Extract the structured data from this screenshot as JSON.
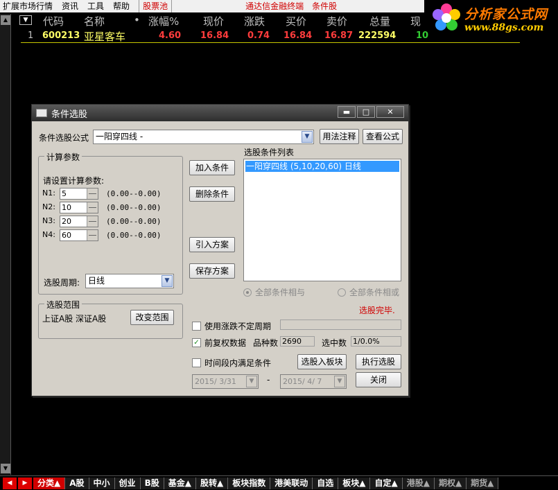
{
  "menu": {
    "items": [
      "扩展市场行情",
      "资讯",
      "工具",
      "帮助"
    ],
    "stock_pool": "股票池",
    "terminal": "通达信金融终端",
    "condition_stock": "条件股"
  },
  "logo": {
    "brand": "分析家公式网",
    "url": "www.88gs.com"
  },
  "table": {
    "headers": [
      "代码",
      "名称",
      "•",
      "涨幅%",
      "现价",
      "涨跌",
      "买价",
      "卖价",
      "总量",
      "现"
    ],
    "row": {
      "index": "1",
      "code": "600213",
      "name": "亚星客车",
      "change_pct": "4.60",
      "price": "16.84",
      "change": "0.74",
      "bid": "16.84",
      "ask": "16.87",
      "volume": "222594",
      "cur": "10"
    }
  },
  "dialog": {
    "title": "条件选股",
    "formula_label": "条件选股公式",
    "formula_value": "一阳穿四线    -",
    "btn_usage": "用法注释",
    "btn_view": "查看公式",
    "params_group": "计算参数",
    "params_hint": "请设置计算参数:",
    "params": [
      {
        "name": "N1:",
        "value": "5",
        "range": "(0.00--0.00)"
      },
      {
        "name": "N2:",
        "value": "10",
        "range": "(0.00--0.00)"
      },
      {
        "name": "N3:",
        "value": "20",
        "range": "(0.00--0.00)"
      },
      {
        "name": "N4:",
        "value": "60",
        "range": "(0.00--0.00)"
      }
    ],
    "period_label": "选股周期:",
    "period_value": "日线",
    "btn_add": "加入条件",
    "btn_delete": "删除条件",
    "btn_import": "引入方案",
    "btn_save": "保存方案",
    "list_label": "选股条件列表",
    "list_item": "一阳穿四线 (5,10,20,60) 日线",
    "radio_and": "全部条件相与",
    "radio_or": "全部条件相或",
    "status": "选股完毕.",
    "scope_group": "选股范围",
    "scope_value": "上证A股 深证A股",
    "btn_scope": "改变范围",
    "chk_volatility": "使用涨跌不定周期",
    "chk_adjust": "前复权数据",
    "count_label": "品种数",
    "count_value": "2690",
    "hit_label": "选中数",
    "hit_value": "1/0.0%",
    "chk_period": "时间段内满足条件",
    "btn_to_block": "选股入板块",
    "btn_run": "执行选股",
    "date_from": "2015/ 3/31",
    "date_sep": "-",
    "date_to": "2015/ 4/ 7",
    "btn_close": "关闭"
  },
  "tabs": [
    "分类▲",
    "A股",
    "中小",
    "创业",
    "B股",
    "基金▲",
    "股转▲",
    "板块指数",
    "港美联动",
    "自选",
    "板块▲",
    "自定▲",
    "港股▲",
    "期权▲",
    "期货▲"
  ],
  "colors": {
    "up": "#ff3c3c",
    "header": "#c0c0c0",
    "accent_red": "#d00000",
    "selection": "#3399ff"
  }
}
